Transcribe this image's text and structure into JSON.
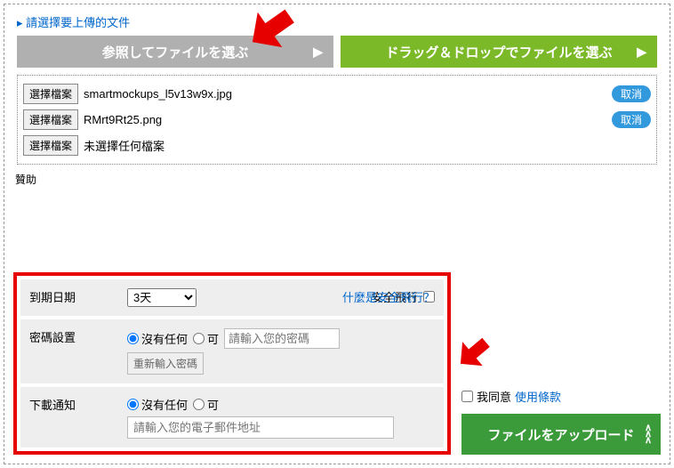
{
  "header": {
    "select_label": "請選擇要上傳的文件"
  },
  "buttons": {
    "browse": "参照してファイルを選ぶ",
    "dragdrop": "ドラッグ＆ドロップでファイルを選ぶ"
  },
  "files": {
    "pick_label": "選擇檔案",
    "rows": [
      {
        "name": "smartmockups_l5v13w9x.jpg",
        "has_cancel": true
      },
      {
        "name": "RMrt9Rt25.png",
        "has_cancel": true
      },
      {
        "name": "未選擇任何檔案",
        "has_cancel": false
      }
    ],
    "cancel_label": "取消"
  },
  "sponsor_label": "贊助",
  "options": {
    "expiry": {
      "label": "到期日期",
      "value": "3天"
    },
    "safe_flight": {
      "label": "安全飛行",
      "link": "什麼是安全飛行？"
    },
    "password": {
      "label": "密碼設置",
      "none": "沒有任何",
      "yes": "可",
      "placeholder": "請輸入您的密碼",
      "retype": "重新輸入密碼"
    },
    "notify": {
      "label": "下載通知",
      "none": "沒有任何",
      "yes": "可",
      "email_placeholder": "請輸入您的電子郵件地址"
    }
  },
  "side": {
    "agree": "我同意",
    "terms": "使用條款",
    "upload": "ファイルをアップロード"
  }
}
